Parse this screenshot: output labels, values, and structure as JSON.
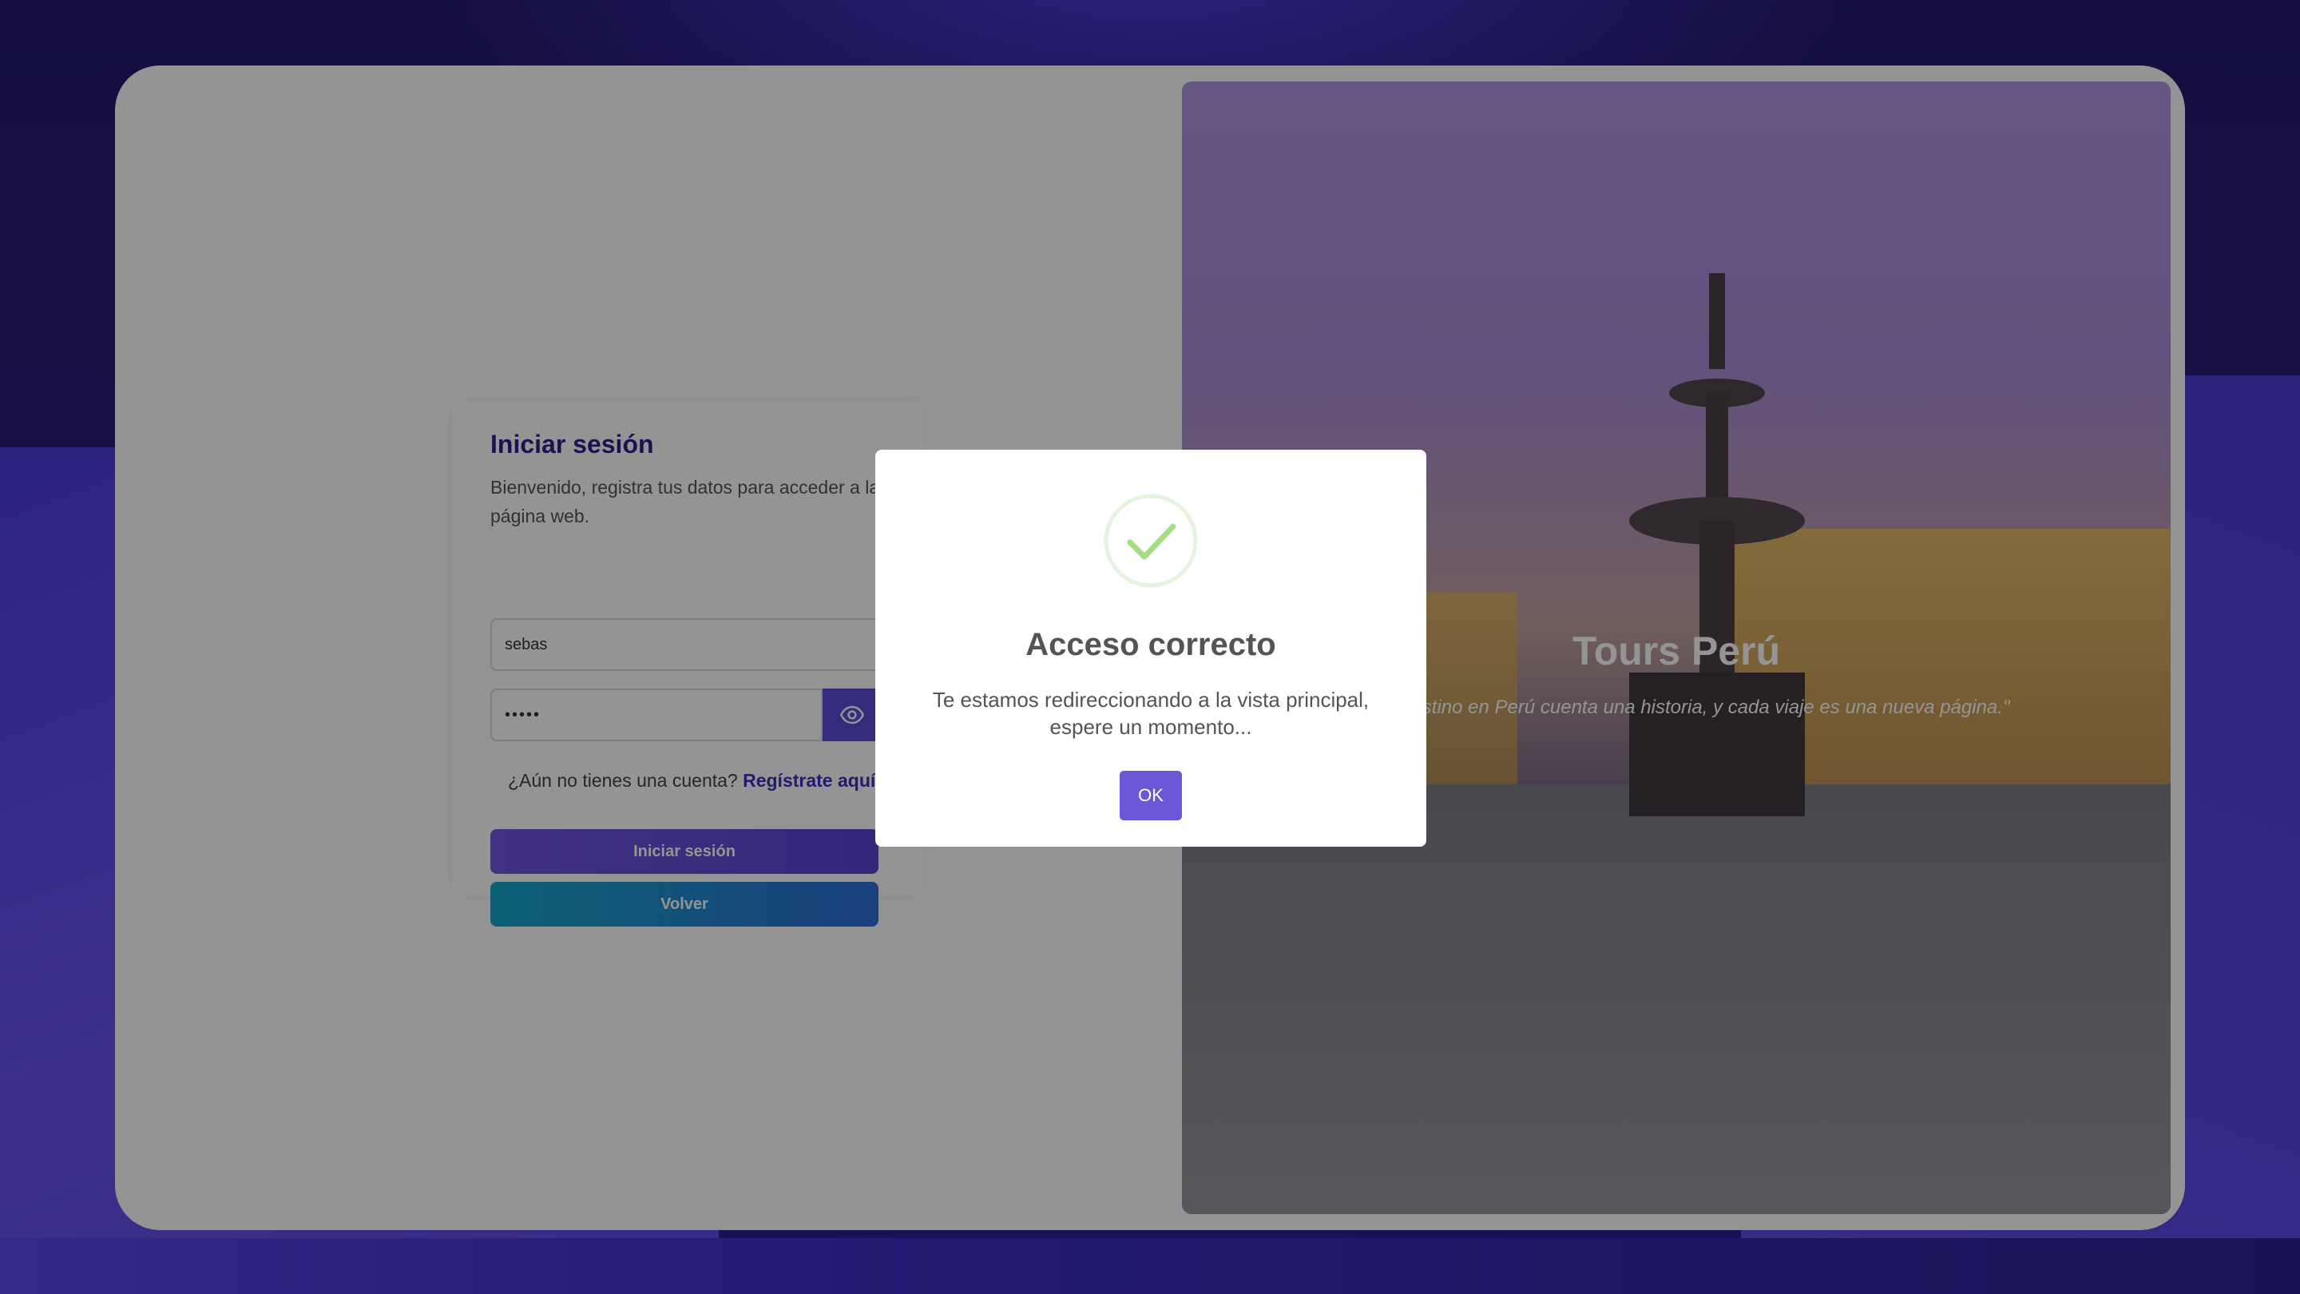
{
  "hero": {
    "title": "Tours Perú",
    "quote": "\"Cada destino en Perú cuenta una historia, y cada viaje es una nueva página.\""
  },
  "login": {
    "title": "Iniciar sesión",
    "subtitle": "Bienvenido, registra tus datos para acceder a la página web.",
    "username_value": "sebas",
    "password_value": "•••••",
    "register_prompt": "¿Aún no tienes una cuenta?",
    "register_link": "Regístrate aquí.",
    "submit_label": "Iniciar sesión",
    "back_label": "Volver"
  },
  "modal": {
    "title": "Acceso correcto",
    "message": "Te estamos redireccionando a la vista principal, espere un momento...",
    "ok_label": "OK"
  },
  "colors": {
    "brand_primary": "#5a4ad6",
    "link": "#3b2fc2",
    "back_button": "#16a6cc",
    "success": "#a5dc86"
  },
  "icons": {
    "password_toggle": "eye-icon",
    "modal_status": "success-check-icon"
  }
}
